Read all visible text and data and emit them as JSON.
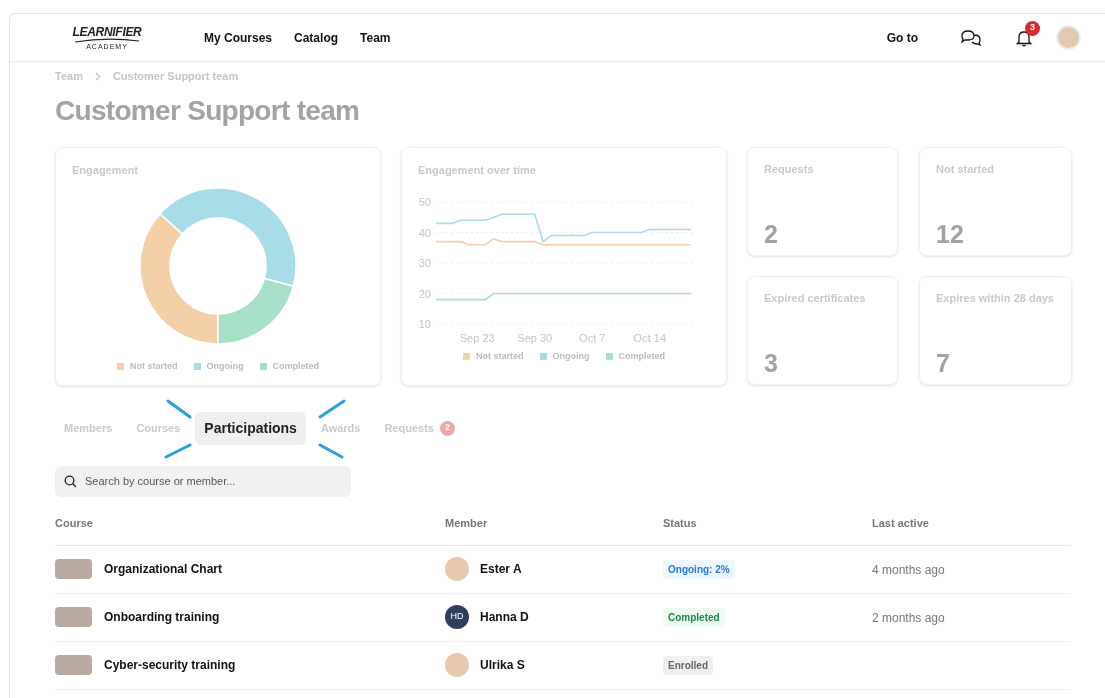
{
  "header": {
    "logo_top": "LEARNIFIER",
    "logo_bottom": "ACADEMY",
    "nav": [
      "My Courses",
      "Catalog",
      "Team"
    ],
    "goto": "Go to",
    "notification_count": "3"
  },
  "breadcrumb": [
    "Team",
    "Customer Support team"
  ],
  "title": "Customer Support team",
  "engagement": {
    "title": "Engagement",
    "legend": [
      {
        "label": "Not started",
        "color": "#f5cfa5"
      },
      {
        "label": "Ongoing",
        "color": "#a6dde9"
      },
      {
        "label": "Completed",
        "color": "#a6e0c6"
      }
    ]
  },
  "engagement_over_time": {
    "title": "Engagement over time",
    "chart_data": {
      "type": "line",
      "categories": [
        null,
        null,
        null,
        null,
        null,
        "Sep 23",
        null,
        null,
        null,
        null,
        null,
        null,
        "Sep 30",
        null,
        null,
        null,
        null,
        null,
        null,
        "Oct 7",
        null,
        null,
        null,
        null,
        null,
        null,
        "Oct 14",
        null,
        null,
        null,
        null,
        null
      ],
      "grid": true,
      "ylim": [
        10,
        50
      ],
      "yticks": [
        10,
        20,
        30,
        40,
        50
      ],
      "series": [
        {
          "name": "Not started",
          "color": "#f5cfa5",
          "values": [
            37,
            37,
            37,
            37,
            36,
            36,
            36,
            38,
            37,
            37,
            37,
            37,
            37,
            36,
            36,
            36,
            36,
            36,
            36,
            36,
            36,
            36,
            36,
            36,
            36,
            36,
            36,
            36,
            36,
            36,
            36,
            36
          ]
        },
        {
          "name": "Ongoing",
          "color": "#a6dde9",
          "values": [
            43,
            43,
            43,
            44,
            44,
            44,
            44,
            45,
            46,
            46,
            46,
            46,
            46,
            37,
            39,
            39,
            39,
            39,
            39,
            40,
            40,
            40,
            40,
            40,
            40,
            40,
            41,
            41,
            41,
            41,
            41,
            41
          ]
        },
        {
          "name": "Completed",
          "color": "#a6e0c6",
          "values": [
            18,
            18,
            18,
            18,
            18,
            18,
            18,
            20,
            20,
            20,
            20,
            20,
            20,
            20,
            20,
            20,
            20,
            20,
            20,
            20,
            20,
            20,
            20,
            20,
            20,
            20,
            20,
            20,
            20,
            20,
            20,
            20
          ]
        }
      ]
    }
  },
  "stats": [
    {
      "label": "Requests",
      "value": "2"
    },
    {
      "label": "Not started",
      "value": "12"
    },
    {
      "label": "Expired certificates",
      "value": "3"
    },
    {
      "label": "Expires within 28 days",
      "value": "7"
    }
  ],
  "tabs": [
    {
      "label": "Members",
      "selected": false
    },
    {
      "label": "Courses",
      "selected": false
    },
    {
      "label": "Participations",
      "selected": true
    },
    {
      "label": "Awards",
      "selected": false
    },
    {
      "label": "Requests",
      "selected": false,
      "badge": "2"
    }
  ],
  "search": {
    "placeholder": "Search by course or member..."
  },
  "table": {
    "columns": [
      "Course",
      "Member",
      "Status",
      "Last active"
    ],
    "rows": [
      {
        "course": "Organizational Chart",
        "member": "Ester A",
        "avatar": {
          "kind": "photo"
        },
        "status": {
          "kind": "ongoing",
          "text": "Ongoing: 2%"
        },
        "last_active": "4 months ago"
      },
      {
        "course": "Onboarding training",
        "member": "Hanna D",
        "avatar": {
          "kind": "initials",
          "text": "HD"
        },
        "status": {
          "kind": "completed",
          "text": "Completed"
        },
        "last_active": "2 months ago"
      },
      {
        "course": "Cyber-security training",
        "member": "Ulrika S",
        "avatar": {
          "kind": "photo"
        },
        "status": {
          "kind": "enrolled",
          "text": "Enrolled"
        }
      }
    ]
  }
}
